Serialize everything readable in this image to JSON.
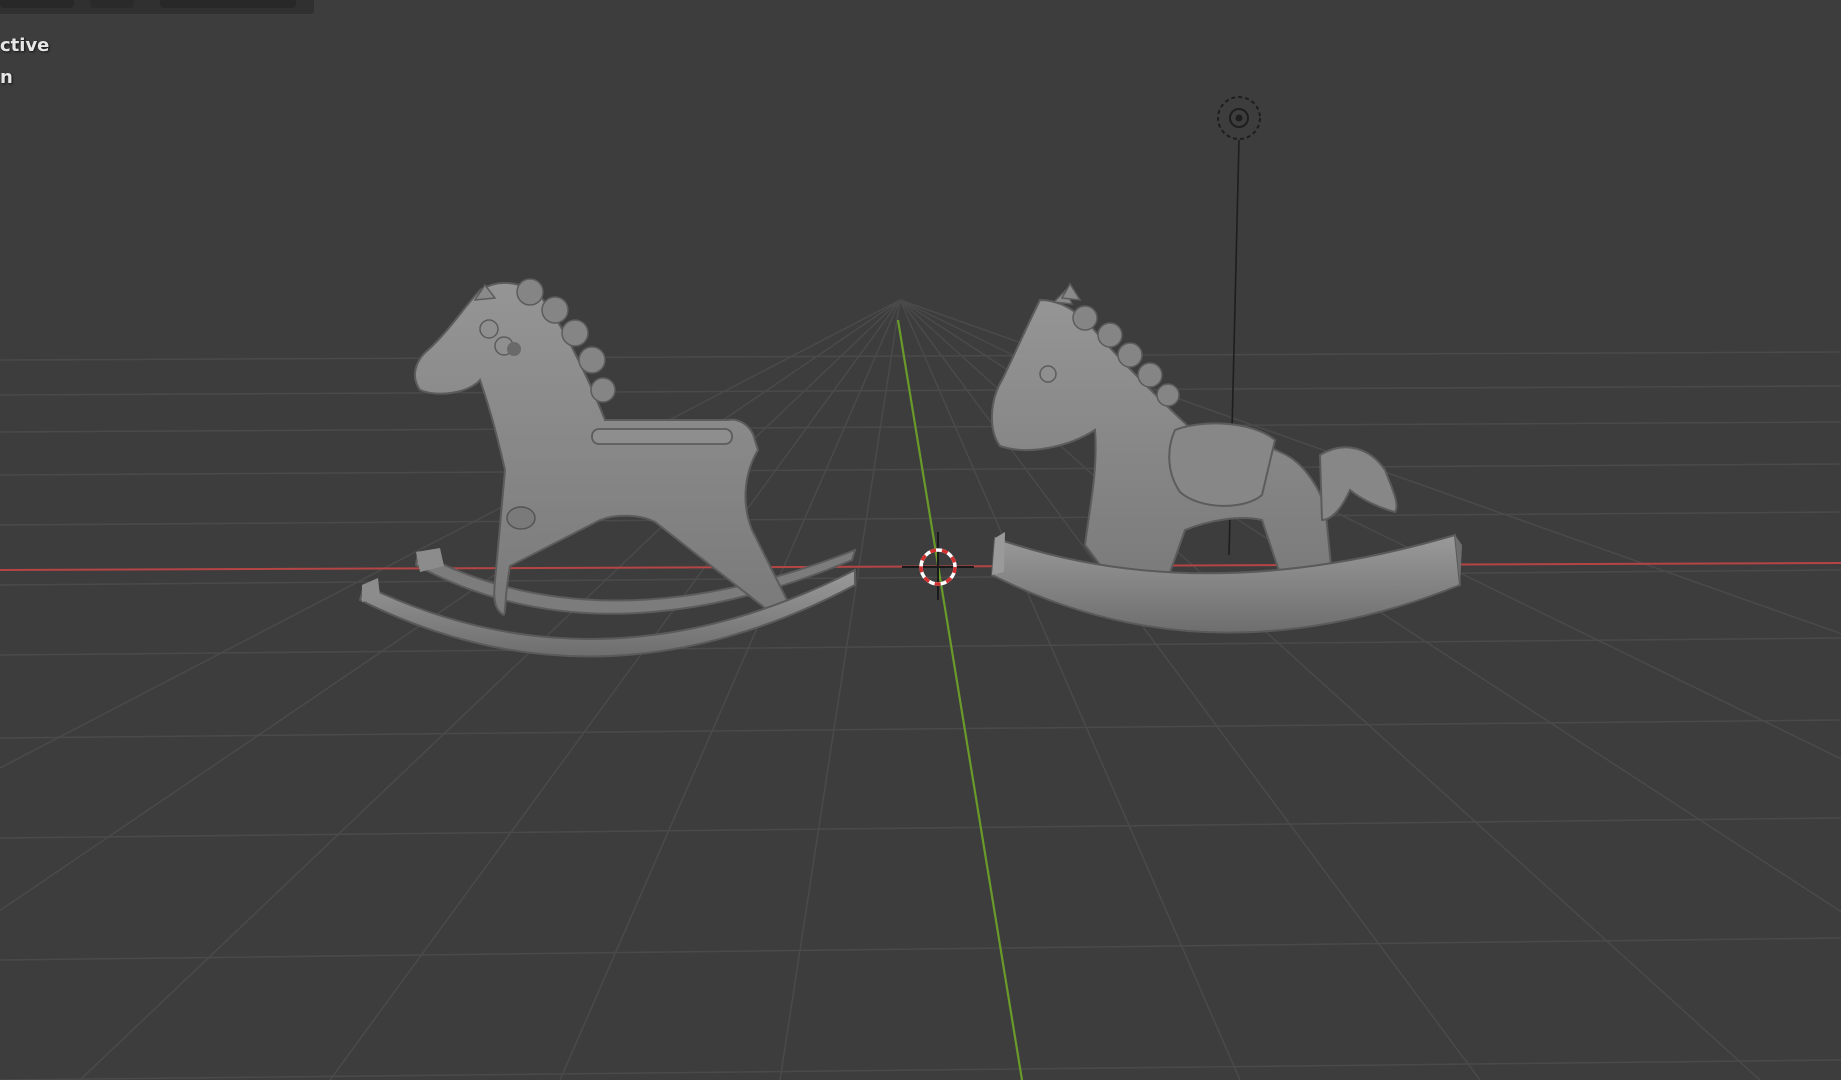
{
  "viewport": {
    "background_color": "#3d3d3d",
    "grid_color": "#4a4a4a",
    "x_axis_color": "#c44848",
    "y_axis_color": "#6a9a2a",
    "object_color": "#8a8a8a"
  },
  "overlay": {
    "line1": "ctive",
    "line2": "n"
  },
  "icons": {
    "cursor": "3d-cursor-icon",
    "light": "light-icon"
  }
}
